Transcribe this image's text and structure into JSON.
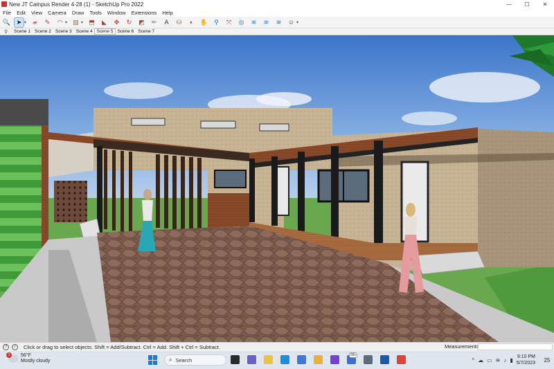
{
  "window": {
    "title": "New JT Campus Render 4-28 (1) - SketchUp Pro 2022",
    "minimize": "—",
    "maximize": "☐",
    "close": "✕"
  },
  "menu": [
    "File",
    "Edit",
    "View",
    "Camera",
    "Draw",
    "Tools",
    "Window",
    "Extensions",
    "Help"
  ],
  "toolbar": [
    {
      "name": "search-icon",
      "glyph": "🔍",
      "color": "#333333"
    },
    {
      "name": "select-arrow-icon",
      "glyph": "➤",
      "color": "#111111",
      "selected": true
    },
    {
      "name": "eraser-icon",
      "glyph": "▰",
      "color": "#e06aa0"
    },
    {
      "name": "pencil-line-icon",
      "glyph": "✎",
      "color": "#c0392b"
    },
    {
      "name": "arc-icon",
      "glyph": "◠",
      "color": "#c0392b"
    },
    {
      "name": "shape-icon",
      "glyph": "▧",
      "color": "#8b7a55"
    },
    {
      "name": "push-pull-icon",
      "glyph": "⬒",
      "color": "#c0392b"
    },
    {
      "name": "follow-me-icon",
      "glyph": "◣",
      "color": "#c0392b"
    },
    {
      "name": "move-icon",
      "glyph": "✥",
      "color": "#c0392b"
    },
    {
      "name": "rotate-icon",
      "glyph": "↻",
      "color": "#c0392b"
    },
    {
      "name": "scale-icon",
      "glyph": "◩",
      "color": "#c0392b"
    },
    {
      "name": "tape-measure-icon",
      "glyph": "✏",
      "color": "#8b6d3a"
    },
    {
      "name": "text-label-icon",
      "glyph": "A",
      "color": "#333333"
    },
    {
      "name": "paint-bucket-icon",
      "glyph": "⛁",
      "color": "#b5651d"
    },
    {
      "name": "orbit-icon",
      "glyph": "◐",
      "color": "#c0392b"
    },
    {
      "name": "pan-icon",
      "glyph": "✋",
      "color": "#c08a5a"
    },
    {
      "name": "zoom-icon",
      "glyph": "⚲",
      "color": "#1f6fb5"
    },
    {
      "name": "zoom-extents-icon",
      "glyph": "⤧",
      "color": "#c0392b"
    },
    {
      "name": "geo-location-icon",
      "glyph": "◎",
      "color": "#1f6fb5"
    },
    {
      "name": "warehouse-icon",
      "glyph": "≋",
      "color": "#1f6fb5"
    },
    {
      "name": "extension-warehouse-icon",
      "glyph": "≋",
      "color": "#1f6fb5"
    },
    {
      "name": "layout-icon",
      "glyph": "≋",
      "color": "#1f6fb5"
    },
    {
      "name": "account-icon",
      "glyph": "☺",
      "color": "#444444"
    }
  ],
  "scenes": {
    "pin": "⚲",
    "tabs": [
      "Scene 1",
      "Scene 2",
      "Scene 3",
      "Scene 4",
      "Scene 5",
      "Scene 6",
      "Scene 7"
    ],
    "active_index": 4
  },
  "status": {
    "geo_icon": "?",
    "info_icon": "i",
    "message": "Click or drag to select objects. Shift = Add/Subtract. Ctrl = Add. Shift + Ctrl = Subtract.",
    "measurements_label": "Measurements",
    "measurements_value": ""
  },
  "taskbar": {
    "weather_badge": "1",
    "temperature": "56°F",
    "condition": "Mostly cloudy",
    "search_placeholder": "Search",
    "apps": [
      {
        "name": "task-view-icon",
        "color": "#2b2b2b"
      },
      {
        "name": "video-call-icon",
        "color": "#6c5fc7"
      },
      {
        "name": "file-explorer-icon",
        "color": "#f0c040"
      },
      {
        "name": "edge-icon",
        "color": "#1a8fd8"
      },
      {
        "name": "store-icon",
        "color": "#3c78d8"
      },
      {
        "name": "mail-icon",
        "color": "#e8b23a"
      },
      {
        "name": "media-icon",
        "color": "#7a3fd0"
      },
      {
        "name": "phone-link-icon",
        "color": "#3a6fd8"
      },
      {
        "name": "settings-icon",
        "color": "#5a6b7d"
      },
      {
        "name": "sketchup-icon",
        "color": "#1a5aa8"
      },
      {
        "name": "chrome-icon",
        "color": "#db4437"
      }
    ],
    "badge_99": "99+",
    "tray_chevron": "^",
    "time": "9:10 PM",
    "date": "5/7/2023",
    "notification_count": "25"
  }
}
